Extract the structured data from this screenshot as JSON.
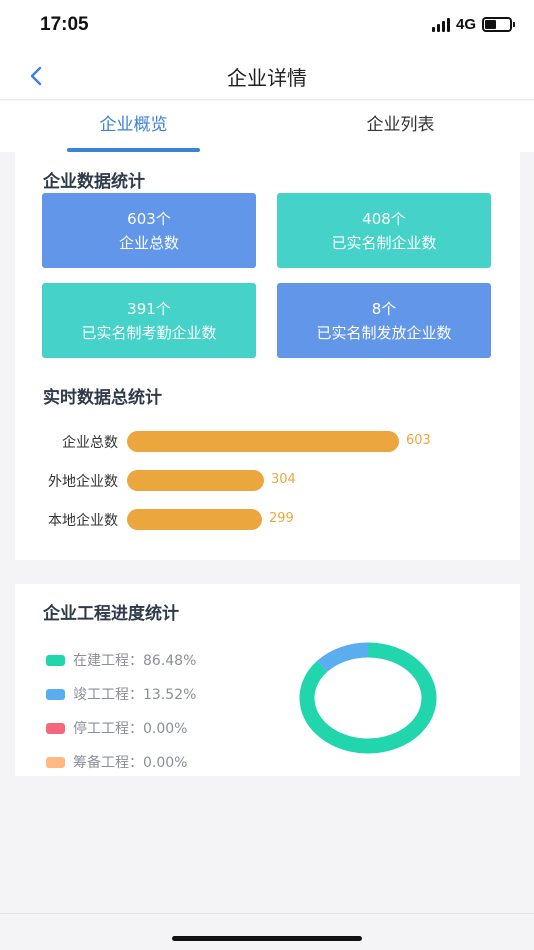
{
  "status_bar": {
    "time": "17:05",
    "network": "4G"
  },
  "nav": {
    "title": "企业详情"
  },
  "tabs": [
    {
      "label": "企业概览",
      "active": true
    },
    {
      "label": "企业列表",
      "active": false
    }
  ],
  "stats_section": {
    "title": "企业数据统计",
    "boxes": [
      {
        "value": "603个",
        "label": "企业总数",
        "color": "#6196e8"
      },
      {
        "value": "408个",
        "label": "已实名制企业数",
        "color": "#45d2c9"
      },
      {
        "value": "391个",
        "label": "已实名制考勤企业数",
        "color": "#45d2c9"
      },
      {
        "value": "8个",
        "label": "已实名制发放企业数",
        "color": "#6196e8"
      }
    ]
  },
  "realtime_section": {
    "title": "实时数据总统计"
  },
  "progress_section": {
    "title": "企业工程进度统计"
  },
  "chart_data": [
    {
      "type": "bar",
      "orientation": "horizontal",
      "categories": [
        "企业总数",
        "外地企业数",
        "本地企业数"
      ],
      "values": [
        603,
        304,
        299
      ],
      "xlim": [
        0,
        603
      ],
      "color": "#eba73e",
      "grid": false
    },
    {
      "type": "pie",
      "donut": true,
      "slices": [
        {
          "label": "在建工程：86.48%",
          "value": 86.48,
          "color": "#21d6ad"
        },
        {
          "label": "竣工工程：13.52%",
          "value": 13.52,
          "color": "#5aaef0"
        },
        {
          "label": "停工工程：0.00%",
          "value": 0.0,
          "color": "#f4687e"
        },
        {
          "label": "筹备工程：0.00%",
          "value": 0.0,
          "color": "#ffb981"
        }
      ],
      "legend": "left"
    }
  ]
}
